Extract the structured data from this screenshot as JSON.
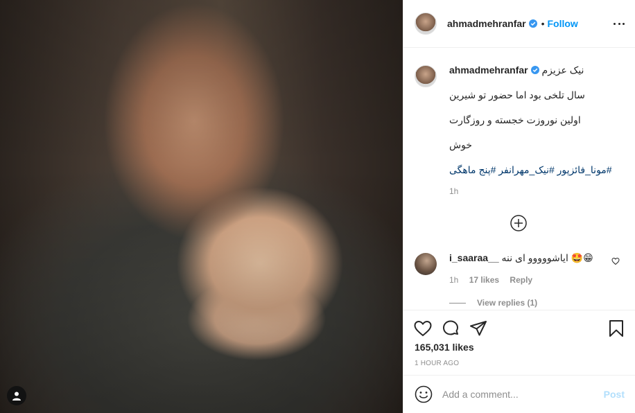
{
  "post": {
    "username": "ahmadmehranfar",
    "follow_label": "Follow",
    "dot": "•",
    "caption_lines": [
      "نیک عزیزم",
      "سال تلخی بود اما حضور تو شیرین",
      "اولین نوروزت خجسته و روزگارت",
      "خوش"
    ],
    "hashtags": "#مونا_فائزپور #نیک_مهرانفر #پنج ماهگی",
    "caption_time": "1h"
  },
  "comment": {
    "username": "i_saaraa__",
    "text": "ایاشووووو ای ننه 🤩😁",
    "time": "1h",
    "likes": "17 likes",
    "reply_label": "Reply",
    "view_replies": "View replies (1)"
  },
  "actions": {
    "likes": "165,031 likes",
    "time_ago": "1 HOUR AGO"
  },
  "composer": {
    "placeholder": "Add a comment...",
    "post_label": "Post"
  },
  "colors": {
    "link_blue": "#0095f6",
    "hashtag": "#00376b",
    "muted": "#8e8e8e"
  }
}
